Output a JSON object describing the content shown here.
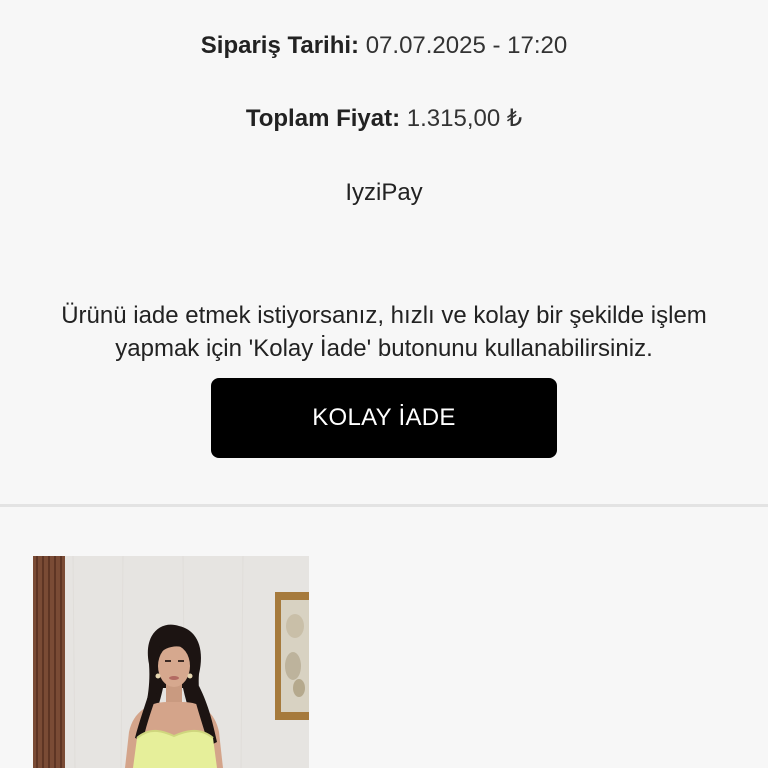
{
  "order": {
    "date_label": "Sipariş Tarihi:",
    "date_value": "07.07.2025 - 17:20",
    "price_label": "Toplam Fiyat:",
    "price_value": "1.315,00 ₺",
    "payment_method": "IyziPay"
  },
  "return_section": {
    "message_line1": "Ürünü iade etmek istiyorsanız, hızlı ve kolay bir şekilde işlem",
    "message_line2": "yapmak için 'Kolay İade' butonunu kullanabilirsiniz.",
    "button_label": "KOLAY İADE"
  },
  "colors": {
    "background": "#f7f7f7",
    "button_bg": "#000000",
    "button_text": "#ffffff",
    "divider": "#e3e3e3",
    "dress": "#e6ef9a"
  }
}
